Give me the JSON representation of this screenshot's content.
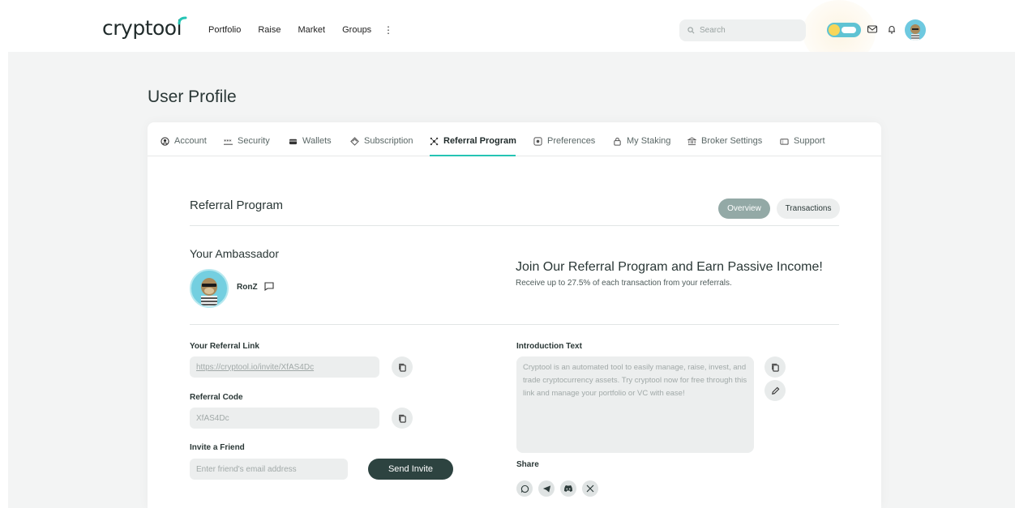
{
  "brand": {
    "logo_text": "cryptool",
    "accent": "#25c4b4"
  },
  "nav": {
    "items": [
      "Portfolio",
      "Raise",
      "Market",
      "Groups"
    ],
    "more": "⋮"
  },
  "search": {
    "placeholder": "Search"
  },
  "page": {
    "title": "User Profile"
  },
  "tabs": [
    {
      "label": "Account",
      "icon": "user-circle-icon"
    },
    {
      "label": "Security",
      "icon": "password-icon"
    },
    {
      "label": "Wallets",
      "icon": "wallet-icon"
    },
    {
      "label": "Subscription",
      "icon": "diamond-icon"
    },
    {
      "label": "Referral Program",
      "icon": "network-icon",
      "active": true
    },
    {
      "label": "Preferences",
      "icon": "settings-square-icon"
    },
    {
      "label": "My Staking",
      "icon": "lock-icon"
    },
    {
      "label": "Broker Settings",
      "icon": "bank-icon"
    },
    {
      "label": "Support",
      "icon": "ticket-icon"
    }
  ],
  "referral": {
    "title": "Referral Program",
    "overview_label": "Overview",
    "transactions_label": "Transactions",
    "ambassador_title": "Your Ambassador",
    "ambassador_name": "RonZ",
    "join_title": "Join Our Referral Program and Earn Passive Income!",
    "join_subtitle": "Receive up to 27.5% of each transaction from your referrals.",
    "link_label": "Your Referral Link",
    "link_value": "https://cryptool.io/invite/XfAS4Dc",
    "code_label": "Referral Code",
    "code_value": "XfAS4Dc",
    "invite_label": "Invite a Friend",
    "invite_placeholder": "Enter friend's email address",
    "send_label": "Send Invite",
    "intro_label": "Introduction Text",
    "intro_text": "Cryptool is an automated tool to easily manage, raise, invest, and trade cryptocurrency assets. Try cryptool now for free through this link and manage your portfolio or VC with ease!",
    "share_label": "Share",
    "share_icons": [
      "whatsapp-icon",
      "telegram-icon",
      "discord-icon",
      "x-icon"
    ]
  }
}
